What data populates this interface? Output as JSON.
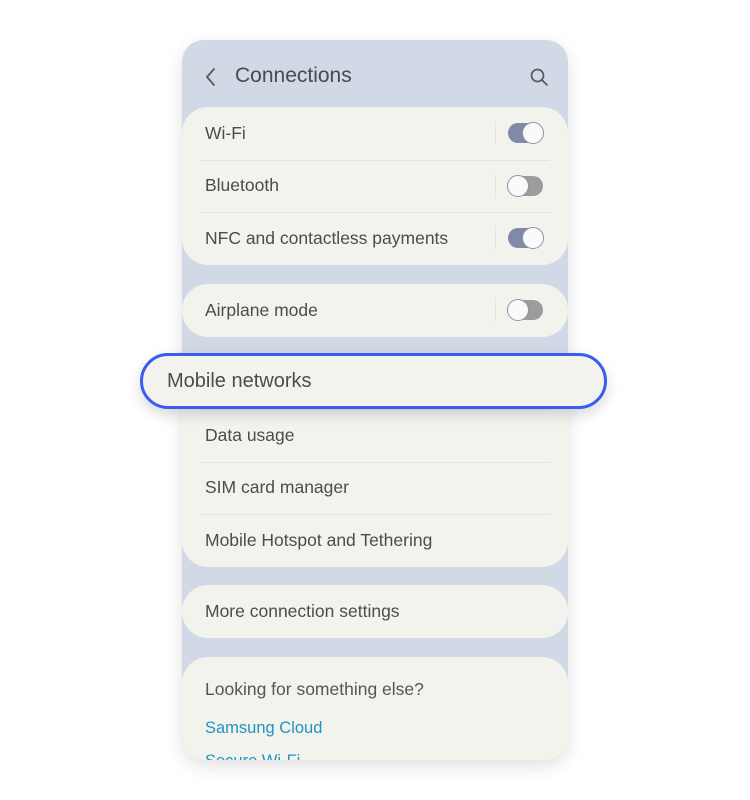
{
  "header": {
    "title": "Connections",
    "back_icon": "chevron-left-icon",
    "search_icon": "search-icon"
  },
  "groups": [
    {
      "items": [
        {
          "label": "Wi-Fi",
          "toggle": true,
          "on": true
        },
        {
          "label": "Bluetooth",
          "toggle": true,
          "on": false
        },
        {
          "label": "NFC and contactless payments",
          "toggle": true,
          "on": true
        }
      ]
    },
    {
      "items": [
        {
          "label": "Airplane mode",
          "toggle": true,
          "on": false
        }
      ]
    },
    {
      "items": [
        {
          "label": "Mobile networks",
          "highlighted": true
        },
        {
          "label": "Data usage"
        },
        {
          "label": "SIM card manager"
        },
        {
          "label": "Mobile Hotspot and Tethering"
        }
      ]
    },
    {
      "items": [
        {
          "label": "More connection settings"
        }
      ]
    }
  ],
  "suggestions": {
    "title": "Looking for something else?",
    "links": [
      "Samsung Cloud",
      "Secure Wi-Fi"
    ]
  },
  "colors": {
    "highlight_border": "#3a5cf0",
    "link": "#2193c4",
    "toggle_on": "#808aa6",
    "toggle_off": "#9c9c9c",
    "background": "#d1d8e6",
    "card": "#f3f3ee"
  }
}
